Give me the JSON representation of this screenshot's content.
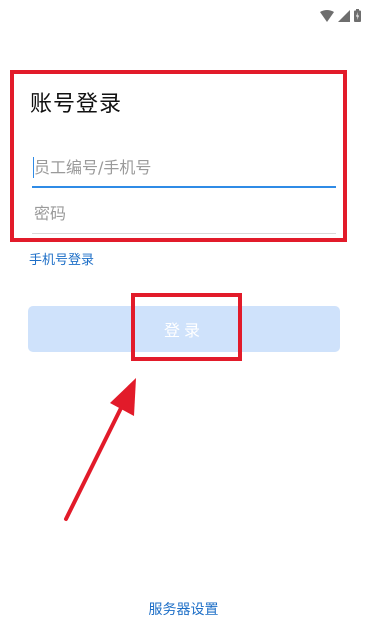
{
  "status_bar": {
    "icons": [
      "wifi-icon",
      "signal-icon",
      "battery-charging-icon"
    ]
  },
  "login": {
    "title": "账号登录",
    "employee_field": {
      "placeholder": "员工编号/手机号",
      "value": ""
    },
    "password_field": {
      "placeholder": "密码",
      "value": ""
    },
    "phone_login_link": "手机号登录",
    "login_button": "登录",
    "server_settings_link": "服务器设置"
  },
  "colors": {
    "accent": "#2f8be6",
    "link": "#1e6fc7",
    "button_disabled_bg": "#cfe2fb",
    "annotation_red": "#e21b2a"
  }
}
